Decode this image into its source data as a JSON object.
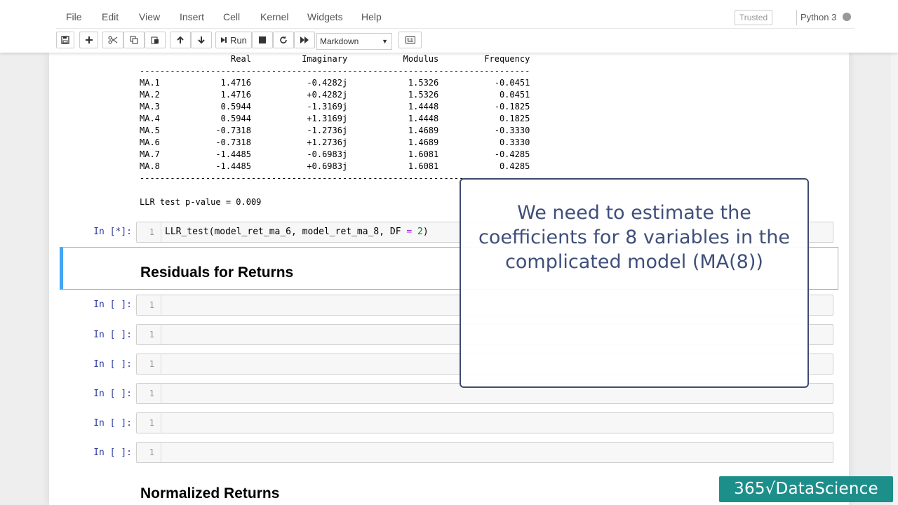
{
  "menu": {
    "items": [
      "File",
      "Edit",
      "View",
      "Insert",
      "Cell",
      "Kernel",
      "Widgets",
      "Help"
    ],
    "trusted": "Trusted",
    "kernel": "Python 3"
  },
  "toolbar": {
    "run_label": "Run",
    "cell_type": "Markdown"
  },
  "output": {
    "header": "                  Real          Imaginary           Modulus         Frequency",
    "rule": "-----------------------------------------------------------------------------",
    "rows": [
      "MA.1            1.4716           -0.4282j            1.5326           -0.0451",
      "MA.2            1.4716           +0.4282j            1.5326            0.0451",
      "MA.3            0.5944           -1.3169j            1.4448           -0.1825",
      "MA.4            0.5944           +1.3169j            1.4448            0.1825",
      "MA.5           -0.7318           -1.2736j            1.4689           -0.3330",
      "MA.6           -0.7318           +1.2736j            1.4689            0.3330",
      "MA.7           -1.4485           -0.6983j            1.6081           -0.4285",
      "MA.8           -1.4485           +0.6983j            1.6081            0.4285"
    ],
    "pvalue": "LLR test p-value = 0.009"
  },
  "cells": {
    "running_prompt": "In [*]:",
    "empty_prompt": "In [ ]:",
    "line_number": "1",
    "code": {
      "fn": "LLR_test(model_ret_ma_6, model_ret_ma_8, DF ",
      "op": "=",
      "space": " ",
      "num": "2",
      "close": ")"
    },
    "heading_residuals": "Residuals for Returns",
    "heading_normalized": "Normalized Returns"
  },
  "callout": {
    "text": "We need to estimate the coefficients for 8 variables in the complicated model (MA(8))"
  },
  "logo": {
    "text": "365√DataScience"
  }
}
